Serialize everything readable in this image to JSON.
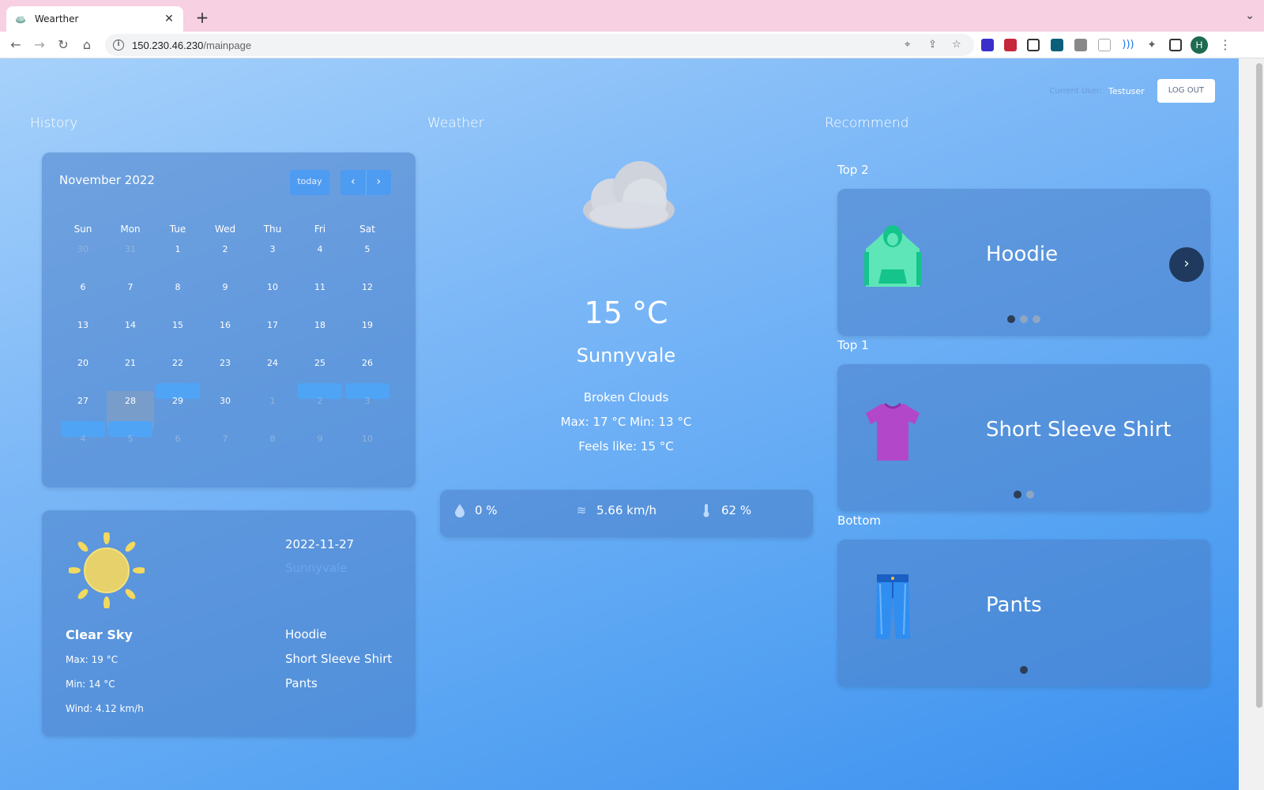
{
  "browser": {
    "tab_title": "Wearther",
    "url_host": "150.230.46.230",
    "url_path": "/mainpage",
    "profile_initial": "H"
  },
  "header": {
    "current_user_label": "Current User:",
    "current_user": "Testuser",
    "logout_label": "LOG OUT"
  },
  "sections": {
    "history": "History",
    "weather": "Weather",
    "recommend": "Recommend"
  },
  "calendar": {
    "title": "November 2022",
    "today_label": "today",
    "prev_icon": "‹",
    "next_icon": "›",
    "weekdays": [
      "Sun",
      "Mon",
      "Tue",
      "Wed",
      "Thu",
      "Fri",
      "Sat"
    ],
    "weeks": [
      [
        "30",
        "31",
        "1",
        "2",
        "3",
        "4",
        "5"
      ],
      [
        "6",
        "7",
        "8",
        "9",
        "10",
        "11",
        "12"
      ],
      [
        "13",
        "14",
        "15",
        "16",
        "17",
        "18",
        "19"
      ],
      [
        "20",
        "21",
        "22",
        "23",
        "24",
        "25",
        "26"
      ],
      [
        "27",
        "28",
        "29",
        "30",
        "1",
        "2",
        "3"
      ],
      [
        "4",
        "5",
        "6",
        "7",
        "8",
        "9",
        "10"
      ]
    ],
    "selected_date": "28",
    "event_dates": [
      "22",
      "25",
      "26",
      "27",
      "28"
    ]
  },
  "history_detail": {
    "condition": "Clear Sky",
    "max": "Max: 19 °C",
    "min": "Min: 14 °C",
    "wind": "Wind: 4.12 km/h",
    "date": "2022-11-27",
    "city": "Sunnyvale",
    "items": [
      "Hoodie",
      "Short Sleeve Shirt",
      "Pants"
    ]
  },
  "weather": {
    "temperature": "15 °C",
    "city": "Sunnyvale",
    "description": "Broken Clouds",
    "max_min": "Max: 17 °C Min: 13 °C",
    "feels_like": "Feels like: 15 °C",
    "precipitation": "0 %",
    "wind": "5.66 km/h",
    "humidity": "62 %",
    "icons": {
      "precipitation": "drop-icon",
      "wind": "wind-icon",
      "humidity": "thermometer-icon"
    }
  },
  "recommend": {
    "top2": {
      "label": "Top 2",
      "item": "Hoodie",
      "dot_count": 3,
      "active_dot": 0
    },
    "top1": {
      "label": "Top 1",
      "item": "Short Sleeve Shirt",
      "dot_count": 2,
      "active_dot": 0
    },
    "bottom": {
      "label": "Bottom",
      "item": "Pants",
      "dot_count": 1,
      "active_dot": 0
    },
    "next_icon": "›"
  },
  "colors": {
    "page_gradient_start": "#a6d1fb",
    "page_gradient_end": "#3b90ef",
    "card": "#4a80c8",
    "button": "#4e9bf2",
    "event_bar": "#4fa4f6"
  }
}
